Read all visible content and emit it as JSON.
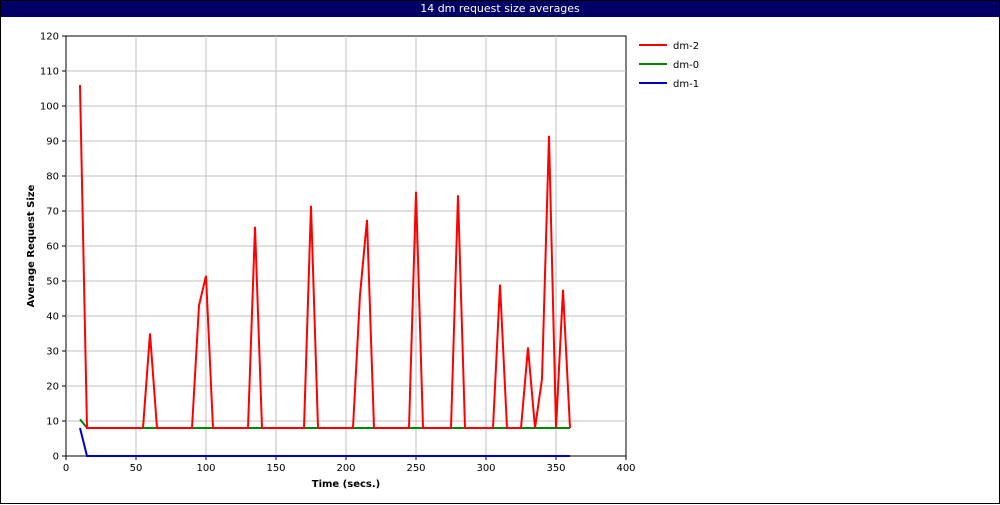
{
  "window": {
    "title": "14 dm request size averages"
  },
  "chart_data": {
    "type": "line",
    "title": "14 dm request size averages",
    "xlabel": "Time (secs.)",
    "ylabel": "Average Request Size",
    "xlim": [
      0,
      400
    ],
    "ylim": [
      0,
      120
    ],
    "xticks": [
      0,
      50,
      100,
      150,
      200,
      250,
      300,
      350,
      400
    ],
    "yticks": [
      0,
      10,
      20,
      30,
      40,
      50,
      60,
      70,
      80,
      90,
      100,
      110,
      120
    ],
    "grid": true,
    "legend_position": "right",
    "series": [
      {
        "name": "dm-2",
        "color": "#ff0000",
        "x": [
          10,
          15,
          20,
          25,
          30,
          35,
          40,
          45,
          50,
          55,
          60,
          65,
          70,
          75,
          80,
          85,
          90,
          95,
          100,
          105,
          110,
          115,
          120,
          125,
          130,
          135,
          140,
          145,
          150,
          155,
          160,
          165,
          170,
          175,
          180,
          185,
          190,
          195,
          200,
          205,
          210,
          215,
          220,
          225,
          230,
          235,
          240,
          245,
          250,
          255,
          260,
          265,
          270,
          275,
          280,
          285,
          290,
          295,
          300,
          305,
          310,
          315,
          320,
          325,
          330,
          335,
          340,
          345,
          350,
          355,
          360
        ],
        "y": [
          106,
          8,
          8,
          8,
          8,
          8,
          8,
          8,
          8,
          8,
          35,
          8,
          8,
          8,
          8,
          8,
          8,
          43,
          51.5,
          8,
          8,
          8,
          8,
          8,
          8,
          65.5,
          8,
          8,
          8,
          8,
          8,
          8,
          8,
          71.5,
          8,
          8,
          8,
          8,
          8,
          8,
          46,
          67.5,
          8,
          8,
          8,
          8,
          8,
          8,
          75.5,
          8,
          8,
          8,
          8,
          8,
          74.5,
          8,
          8,
          8,
          8,
          8,
          49,
          8,
          8,
          8,
          31,
          8,
          22,
          91.5,
          8,
          47.5,
          8
        ]
      },
      {
        "name": "dm-0",
        "color": "#008800",
        "x": [
          10,
          15,
          360
        ],
        "y": [
          10.5,
          8,
          8
        ]
      },
      {
        "name": "dm-1",
        "color": "#0000cc",
        "x": [
          10,
          15,
          360
        ],
        "y": [
          8,
          0,
          0
        ]
      }
    ]
  }
}
